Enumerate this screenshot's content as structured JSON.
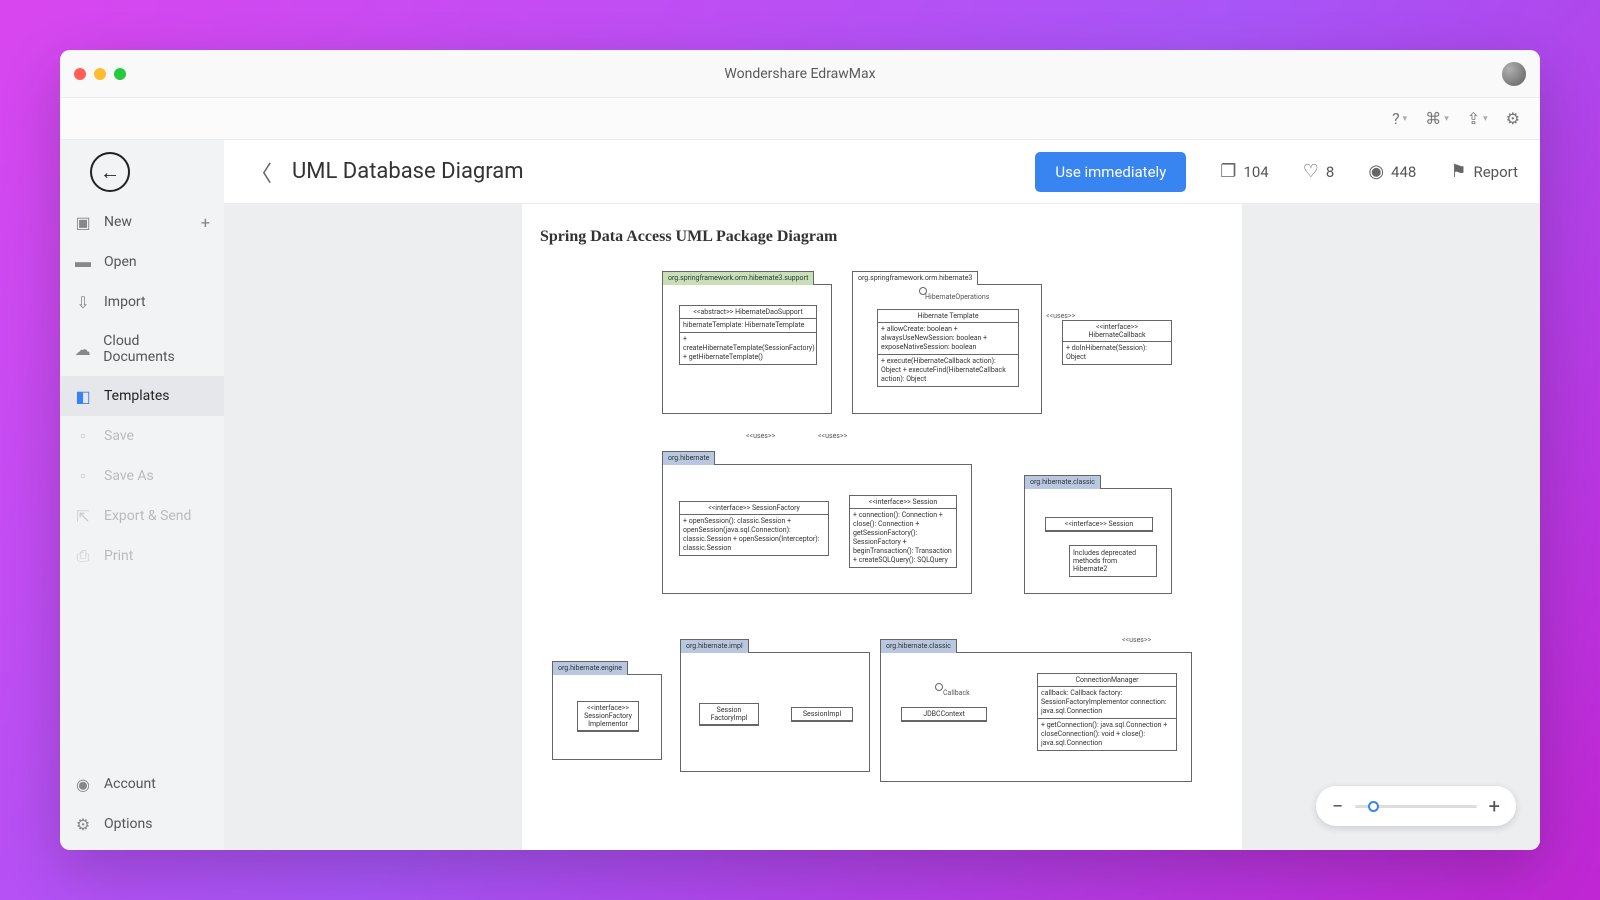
{
  "app_title": "Wondershare EdrawMax",
  "sidebar": {
    "items": [
      {
        "label": "New",
        "has_plus": true,
        "name": "sidebar-item-new"
      },
      {
        "label": "Open",
        "name": "sidebar-item-open"
      },
      {
        "label": "Import",
        "name": "sidebar-item-import"
      },
      {
        "label": "Cloud Documents",
        "name": "sidebar-item-cloud-documents"
      },
      {
        "label": "Templates",
        "name": "sidebar-item-templates",
        "active": true
      },
      {
        "label": "Save",
        "name": "sidebar-item-save",
        "disabled": true
      },
      {
        "label": "Save As",
        "name": "sidebar-item-save-as",
        "disabled": true
      },
      {
        "label": "Export & Send",
        "name": "sidebar-item-export-send",
        "disabled": true
      },
      {
        "label": "Print",
        "name": "sidebar-item-print",
        "disabled": true
      }
    ],
    "footer": [
      {
        "label": "Account",
        "name": "sidebar-item-account"
      },
      {
        "label": "Options",
        "name": "sidebar-item-options"
      }
    ]
  },
  "header": {
    "title": "UML Database Diagram",
    "use_button": "Use immediately",
    "copies": "104",
    "likes": "8",
    "views": "448",
    "report": "Report"
  },
  "document": {
    "title": "Spring Data Access UML Package Diagram",
    "packages": {
      "p1": "org.springframework.orm.hibernate3.support",
      "p2": "org.springframework.orm.hibernate3",
      "p3": "org.hibernate",
      "p4": "org.hibernate.classic",
      "p5": "org.hibernate.impl",
      "p6": "org.hibernate.engine",
      "p7": "org.hibernate.classic"
    },
    "classes": {
      "c1_name": "<<abstract>> HibernateDaoSupport",
      "c1_body": "hibernateTemplate: HibernateTemplate",
      "c1_body2": "+ createHibernateTemplate(SessionFactory)\n+ getHibernateTemplate()",
      "c2_head": "HibernateOperations",
      "c2_name": "Hibernate Template",
      "c2_body": "+ allowCreate: boolean\n+ alwaysUseNewSession: boolean\n+ exposeNativeSession: boolean",
      "c2_body2": "+ execute(HibernateCallback action): Object\n+ executeFind(HibernateCallback action): Object",
      "c3_name": "<<interface>>\nHibernateCallback",
      "c3_body": "+ doInHibernate(Session): Object",
      "c4_name": "<<interface>> SessionFactory",
      "c4_body": "+ openSession(): classic.Session\n+ openSession(java.sql.Connection): classic.Session\n+ openSession(Interceptor): classic.Session",
      "c5_name": "<<interface>> Session",
      "c5_body": "+ connection(): Connection\n+ close(): Connection\n+ getSessionFactory(): SessionFactory\n+ beginTransaction(): Transaction\n+ createSQLQuery(): SQLQuery",
      "c6_name": "<<interface>> Session",
      "c7_note": "Includes deprecated\nmethods from Hibernate2",
      "c8_name": "<<interface>>\nSessionFactory\nImplementor",
      "c9_name": "Session\nFactoryImpl",
      "c10_name": "SessionImpl",
      "c11_name": "JDBCContext",
      "c11_head": "Callback",
      "c12_name": "ConnectionManager",
      "c12_body": "callback: Callback\nfactory: SessionFactoryImplementor\nconnection: java.sql.Connection",
      "c12_body2": "+ getConnection(): java.sql.Connection\n+ closeConnection(): void\n+ close(): java.sql.Connection"
    },
    "stereotypes": {
      "uses": "<<uses>>"
    }
  }
}
